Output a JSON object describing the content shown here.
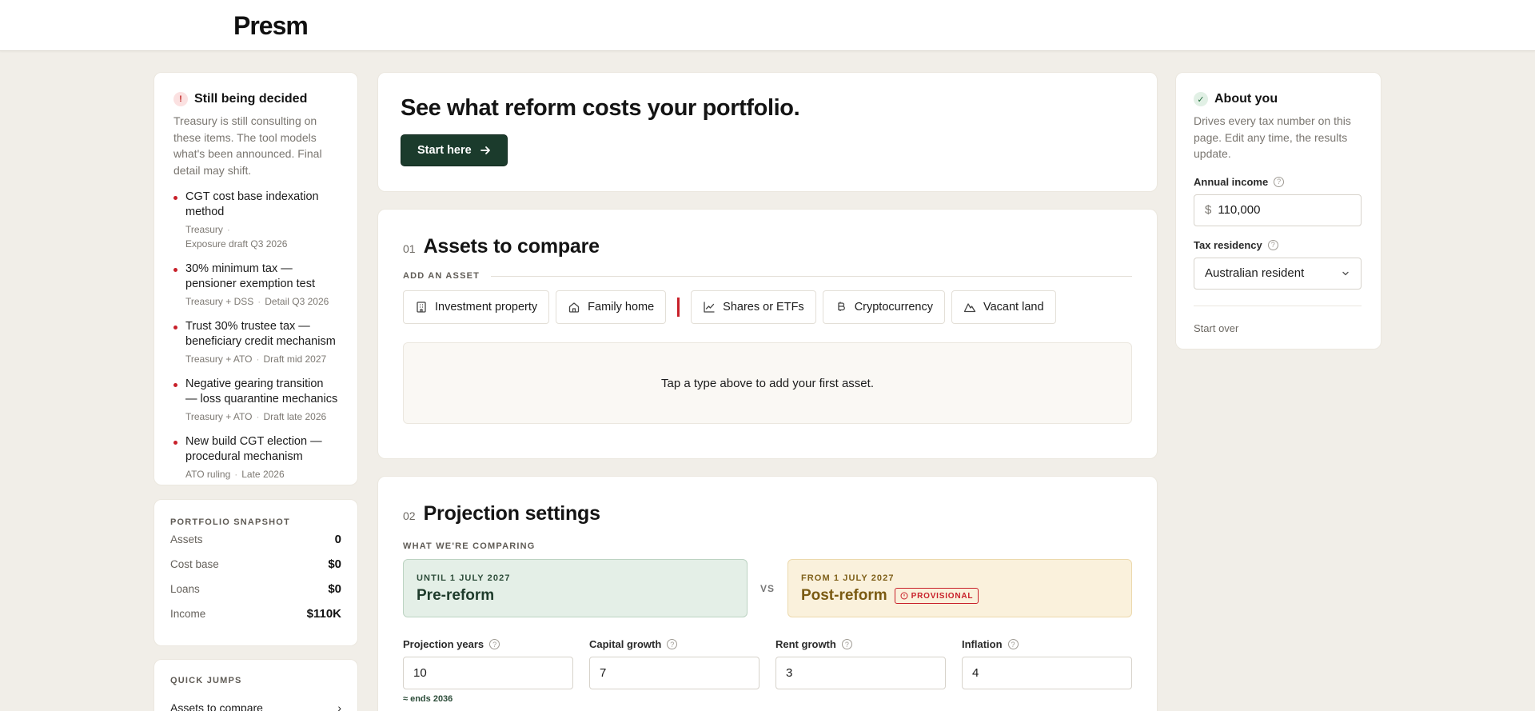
{
  "app": {
    "logo": "Presm"
  },
  "decided": {
    "icon": "!",
    "title": "Still being decided",
    "desc": "Treasury is still consulting on these items. The tool models what's been announced. Final detail may shift.",
    "items": [
      {
        "title": "CGT cost base indexation method",
        "source": "Treasury",
        "when": "Exposure draft Q3 2026"
      },
      {
        "title": "30% minimum tax — pensioner exemption test",
        "source": "Treasury + DSS",
        "when": "Detail Q3 2026"
      },
      {
        "title": "Trust 30% trustee tax — beneficiary credit mechanism",
        "source": "Treasury + ATO",
        "when": "Draft mid 2027"
      },
      {
        "title": "Negative gearing transition — loss quarantine mechanics",
        "source": "Treasury + ATO",
        "when": "Draft late 2026"
      },
      {
        "title": "New build CGT election — procedural mechanism",
        "source": "ATO ruling",
        "when": "Late 2026"
      }
    ]
  },
  "snapshot": {
    "eyebrow": "PORTFOLIO SNAPSHOT",
    "rows": [
      {
        "label": "Assets",
        "value": "0"
      },
      {
        "label": "Cost base",
        "value": "$0"
      },
      {
        "label": "Loans",
        "value": "$0"
      },
      {
        "label": "Income",
        "value": "$110K"
      }
    ]
  },
  "quick": {
    "eyebrow": "QUICK JUMPS",
    "link1": "Assets to compare",
    "chevron": "›"
  },
  "hero": {
    "title": "See what reform costs your portfolio.",
    "cta": "Start here",
    "cta_icon": "arrow-right-icon"
  },
  "assets": {
    "num": "01",
    "title": "Assets to compare",
    "add_label": "ADD AN ASSET",
    "types": [
      {
        "label": "Investment property",
        "icon": "building-icon"
      },
      {
        "label": "Family home",
        "icon": "home-icon"
      },
      {
        "label": "Shares or ETFs",
        "icon": "chart-line-icon"
      },
      {
        "label": "Cryptocurrency",
        "icon": "bitcoin-icon"
      },
      {
        "label": "Vacant land",
        "icon": "land-icon"
      }
    ],
    "empty": "Tap a type above to add your first asset."
  },
  "projection": {
    "num": "02",
    "title": "Projection settings",
    "comparing_label": "WHAT WE'RE COMPARING",
    "pre": {
      "eyebrow": "UNTIL 1 JULY 2027",
      "title": "Pre-reform"
    },
    "vs": "VS",
    "post": {
      "eyebrow": "FROM 1 JULY 2027",
      "title": "Post-reform",
      "badge": "PROVISIONAL"
    },
    "fields": [
      {
        "label": "Projection years",
        "value": "10",
        "hint": "≈ ends 2036"
      },
      {
        "label": "Capital growth",
        "value": "7"
      },
      {
        "label": "Rent growth",
        "value": "3"
      },
      {
        "label": "Inflation",
        "value": "4"
      }
    ]
  },
  "about": {
    "title": "About you",
    "desc": "Drives every tax number on this page. Edit any time, the results update.",
    "income_label": "Annual income",
    "currency": "$",
    "income_value": "110,000",
    "residency_label": "Tax residency",
    "residency_value": "Australian resident",
    "start_over": "Start over"
  },
  "colors": {
    "primary": "#1b3b2c",
    "accent_red": "#c8202a",
    "background": "#f1eee8",
    "pre_bg": "#e4efe7",
    "post_bg": "#faf1dc"
  }
}
